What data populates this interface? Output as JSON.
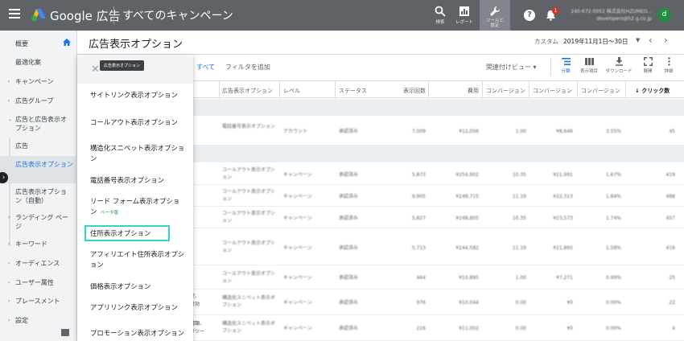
{
  "header": {
    "brand": "Google 広告",
    "campaign_title": "すべてのキャンペーン",
    "search_label": "検索",
    "report_label": "レポート",
    "tools_label": "ツールと\n設定",
    "help_glyph": "?",
    "notification_count": "1",
    "account_line1": "240-672-0052 株式会社HZUMEO...",
    "account_line2": "developers@h2.g.co.jp",
    "avatar_initial": "d"
  },
  "sidebar": {
    "items": [
      {
        "label": "概要",
        "arrow": ""
      },
      {
        "label": "最適化案",
        "arrow": ""
      },
      {
        "label": "キャンペーン",
        "arrow": "›"
      },
      {
        "label": "広告グループ",
        "arrow": "›"
      },
      {
        "label": "広告と広告表示オプション",
        "arrow": "⌄"
      },
      {
        "label": "広告",
        "arrow": ""
      },
      {
        "label": "広告表示オプション",
        "arrow": ""
      },
      {
        "label": "広告表示オプション（自動）",
        "arrow": ""
      },
      {
        "label": "ランディング ページ",
        "arrow": "›"
      },
      {
        "label": "キーワード",
        "arrow": "›"
      },
      {
        "label": "オーディエンス",
        "arrow": "›"
      },
      {
        "label": "ユーザー属性",
        "arrow": "›"
      },
      {
        "label": "プレースメント",
        "arrow": "›"
      },
      {
        "label": "設定",
        "arrow": "›"
      }
    ]
  },
  "page": {
    "title": "広告表示オプション",
    "date_label": "カスタム",
    "date_value": "2019年11月1日〜30日"
  },
  "toolbar": {
    "filter_all": "：すべて",
    "add_filter": "フィルタを追加",
    "related_view": "関連付けビュー ▾",
    "tools": [
      {
        "label": "分類"
      },
      {
        "label": "表示項目"
      },
      {
        "label": "ダウンロード"
      },
      {
        "label": "展開"
      },
      {
        "label": "詳細"
      }
    ]
  },
  "table": {
    "columns": [
      "広告表示オプション",
      "レベル",
      "ステータス",
      "表示回数",
      "費用",
      "コンバージョン",
      "コンバージョン",
      "コンバージョン",
      "↓ クリック数"
    ],
    "rows": [
      {
        "ext": "電話番号表示オプション",
        "level": "アカウント",
        "status": "承認済み",
        "impr": "7,009",
        "cost": "¥12,056",
        "c1": "1.00",
        "c2": "¥8,646",
        "c3": "3.55%",
        "clicks": "45"
      },
      {
        "ext": "コールアウト表示オプション",
        "level": "キャンペーン",
        "status": "承認済み",
        "impr": "5,873",
        "cost": "¥254,902",
        "c1": "10.35",
        "c2": "¥21,991",
        "c3": "1.67%",
        "clicks": "419"
      },
      {
        "ext": "コールアウト表示オプション",
        "level": "キャンペーン",
        "status": "承認済み",
        "impr": "9,905",
        "cost": "¥249,715",
        "c1": "11.19",
        "c2": "¥22,313",
        "c3": "1.84%",
        "clicks": "488"
      },
      {
        "ext": "コールアウト表示オプション",
        "level": "キャンペーン",
        "status": "承認済み",
        "impr": "5,827",
        "cost": "¥248,805",
        "c1": "10.35",
        "c2": "¥23,573",
        "c3": "1.74%",
        "clicks": "457"
      },
      {
        "ext": "コールアウト表示オプション",
        "level": "キャンペーン",
        "status": "承認済み",
        "impr": "5,713",
        "cost": "¥244,582",
        "c1": "11.19",
        "c2": "¥21,865",
        "c3": "1.58%",
        "clicks": "416"
      },
      {
        "ext": "コールアウト表示オプション",
        "level": "キャンペーン",
        "status": "承認済み",
        "impr": "464",
        "cost": "¥10,895",
        "c1": "1.00",
        "c2": "¥7,271",
        "c3": "0.99%",
        "clicks": "25"
      },
      {
        "ext": "構造化スニペット表示オプション",
        "level": "キャンペーン",
        "status": "承認済み",
        "impr": "976",
        "cost": "¥10,044",
        "c1": "0.00",
        "c2": "¥0",
        "c3": "0.00%",
        "clicks": "22"
      },
      {
        "ext": "構造化スニペット表示オプション",
        "level": "キャンペーン",
        "status": "承認済み",
        "impr": "216",
        "cost": "¥11,002",
        "c1": "0.00",
        "c2": "¥0",
        "c3": "0.00%",
        "clicks": "4"
      }
    ],
    "row_snippets": [
      "型、",
      "対効",
      "種類、",
      "ボツー"
    ]
  },
  "panel": {
    "tooltip": "広告表示オプション",
    "close_glyph": "✕",
    "options": [
      "サイトリンク表示オプション",
      "コールアウト表示オプション",
      "構造化スニペット表示オプション",
      "電話番号表示オプション",
      "リード フォーム表示オプション",
      "住所表示オプション",
      "アフィリエイト住所表示オプション",
      "価格表示オプション",
      "アプリリンク表示オプション",
      "プロモーション表示オプション"
    ],
    "beta_label": "ベータ版"
  },
  "colors": {
    "topbar": "#5f6368",
    "accent": "#1a73e8",
    "highlight": "#2fd6c4",
    "sidebar_bg": "#f1f3f4"
  },
  "icons": [
    "menu-icon",
    "google-ads-logo",
    "search-icon",
    "report-icon",
    "wrench-icon",
    "help-icon",
    "bell-icon",
    "home-icon",
    "segment-icon",
    "columns-icon",
    "download-icon",
    "expand-icon",
    "more-icon",
    "close-icon",
    "feedback-icon"
  ]
}
